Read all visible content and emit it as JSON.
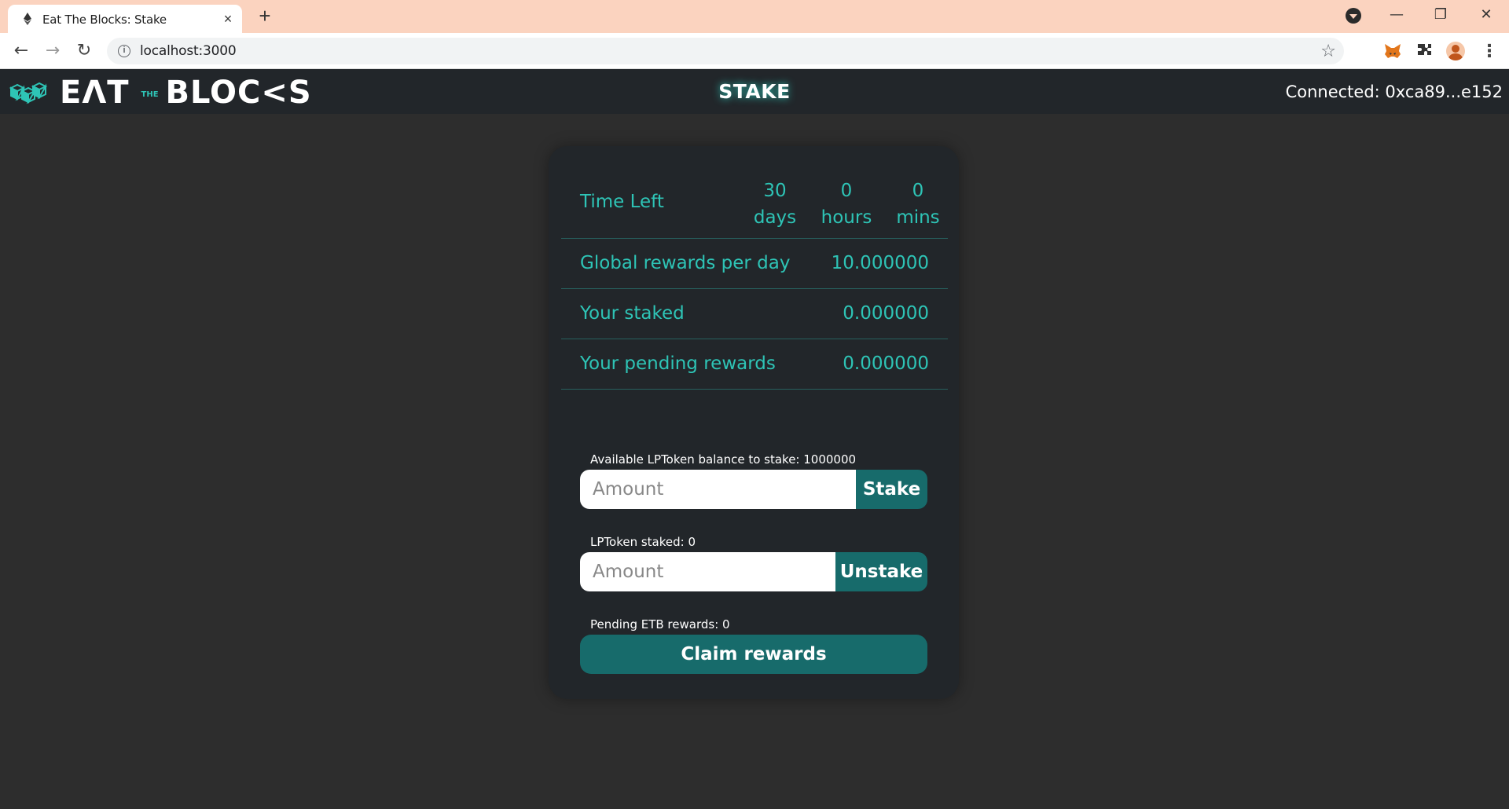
{
  "browser": {
    "tab_title": "Eat The Blocks: Stake",
    "tab_close": "×",
    "new_tab": "+",
    "url": "localhost:3000",
    "minimize": "—",
    "restore": "❐",
    "close": "✕"
  },
  "header": {
    "logo_left": "EΛT",
    "logo_the": "THE",
    "logo_right": "BLOC<S",
    "title": "STAKE",
    "connected": "Connected: 0xca89...e152"
  },
  "stats": {
    "time_left_label": "Time Left",
    "days_value": "30",
    "days_unit": "days",
    "hours_value": "0",
    "hours_unit": "hours",
    "mins_value": "0",
    "mins_unit": "mins",
    "global_rewards_label": "Global rewards per day",
    "global_rewards_value": "10.000000",
    "your_staked_label": "Your staked",
    "your_staked_value": "0.000000",
    "pending_label": "Your pending rewards",
    "pending_value": "0.000000"
  },
  "stake": {
    "hint": "Available LPToken balance to stake: 1000000",
    "placeholder": "Amount",
    "button": "Stake"
  },
  "unstake": {
    "hint": "LPToken staked: 0",
    "placeholder": "Amount",
    "button": "Unstake"
  },
  "claim": {
    "hint": "Pending ETB rewards: 0",
    "button": "Claim rewards"
  },
  "colors": {
    "accent": "#2ec4b6",
    "button": "#176b6b",
    "card": "#22262a",
    "background": "#2d2d2d",
    "tabstrip": "#fbd3bf"
  }
}
